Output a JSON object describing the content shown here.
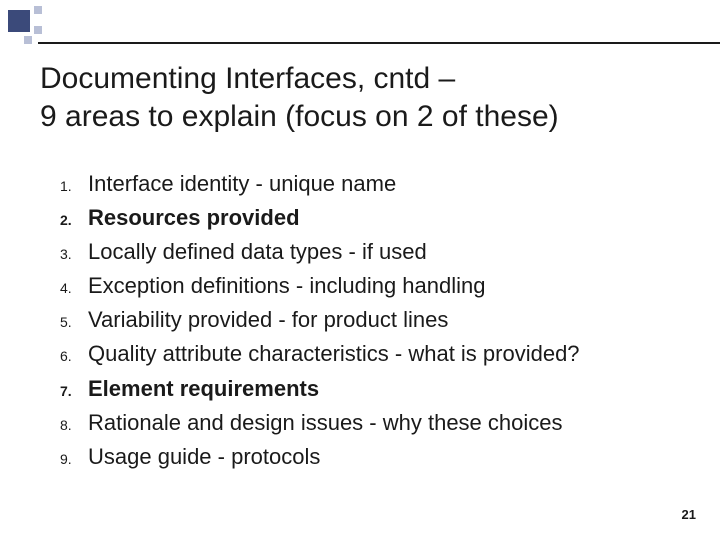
{
  "title_line1": "Documenting Interfaces, cntd –",
  "title_line2": "9 areas to explain (focus on 2 of these)",
  "items": [
    {
      "num": "1.",
      "text": "Interface identity - unique name",
      "bold": false
    },
    {
      "num": "2.",
      "text": "Resources provided",
      "bold": true
    },
    {
      "num": "3.",
      "text": "Locally defined data types - if used",
      "bold": false
    },
    {
      "num": "4.",
      "text": "Exception definitions - including handling",
      "bold": false
    },
    {
      "num": "5.",
      "text": "Variability provided - for product lines",
      "bold": false
    },
    {
      "num": "6.",
      "text": "Quality attribute characteristics - what is provided?",
      "bold": false
    },
    {
      "num": "7.",
      "text": "Element requirements",
      "bold": true
    },
    {
      "num": "8.",
      "text": "Rationale and design issues - why these choices",
      "bold": false
    },
    {
      "num": "9.",
      "text": "Usage guide - protocols",
      "bold": false
    }
  ],
  "page_number": "21"
}
